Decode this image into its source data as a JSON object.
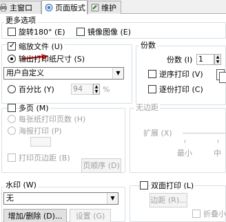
{
  "tabs": [
    {
      "label": "主窗口"
    },
    {
      "label": "页面版式"
    },
    {
      "label": "维护"
    }
  ],
  "more_options": {
    "title": "更多选项",
    "rotate_label": "旋转180° (E)",
    "mirror_label": "镜像图像 (E)"
  },
  "scaling": {
    "scaled_label": "缩放文件 (U)",
    "output_size_label": "输出打印纸尺寸 (S)",
    "paper_select_value": "用户自定义",
    "percent_label": "百分比 (Y)",
    "percent_value": "94",
    "percent_unit": "%"
  },
  "copies": {
    "title": "份数",
    "copies_label": "份数 (I)",
    "copies_value": "1",
    "reverse_label": "逆序打印 (V)",
    "collate_label": "逐份打印 (C)"
  },
  "multipage": {
    "multipage_label": "多页 (M)",
    "n_up_label": "每张纸打印页数 (H)",
    "poster_label": "海报打印 (P)",
    "borders_label": "打印页边距 (B)",
    "order_button": "页顺序 (D)"
  },
  "no_margin": {
    "title": "无边距",
    "expand_label": "扩展 (X)",
    "min_label": "最小",
    "mid_label": "中"
  },
  "watermark": {
    "title": "水印 (W)",
    "select_value": "无",
    "add_remove_button": "增加/删除 (D)...",
    "settings_button": "设置 (G)"
  },
  "duplex": {
    "duplex_label": "双面打印 (L)",
    "margin_button": "边距 (R)...",
    "fold_label": "折叠小"
  }
}
